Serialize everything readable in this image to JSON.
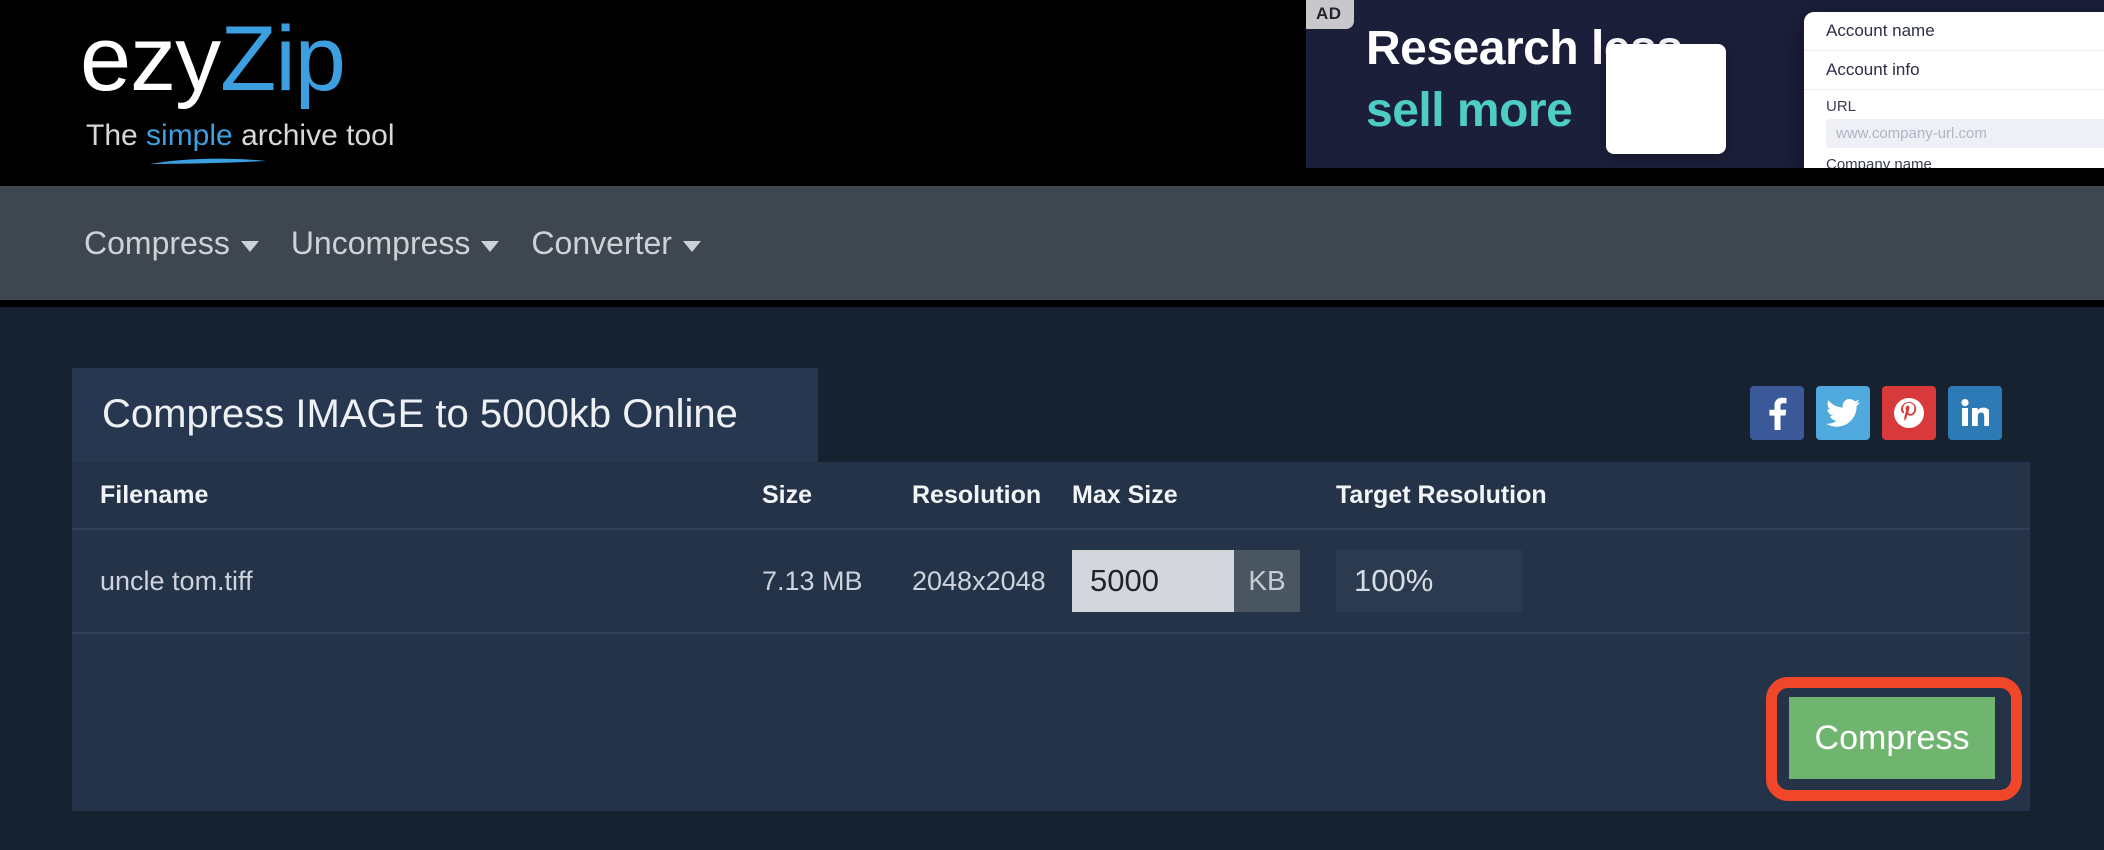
{
  "header": {
    "logo_primary": "ezy",
    "logo_secondary": "Zip",
    "tagline_before": "The ",
    "tagline_highlight": "simple",
    "tagline_after": " archive tool"
  },
  "ad": {
    "badge": "AD",
    "line1": "Research less,",
    "line2": "sell more",
    "mock": {
      "account_name": "Account name",
      "account_info": "Account info",
      "url_label": "URL",
      "url_placeholder": "www.company-url.com",
      "company_name": "Company name"
    }
  },
  "nav": {
    "items": [
      {
        "label": "Compress",
        "icon": "chevron-down-icon"
      },
      {
        "label": "Uncompress",
        "icon": "chevron-down-icon"
      },
      {
        "label": "Converter",
        "icon": "chevron-down-icon"
      }
    ]
  },
  "card": {
    "title": "Compress IMAGE to 5000kb Online",
    "social": [
      {
        "name": "facebook",
        "glyph": "f",
        "color": "#3b5998"
      },
      {
        "name": "twitter",
        "glyph": "t",
        "color": "#4fa9dd"
      },
      {
        "name": "pinterest",
        "glyph": "p",
        "color": "#d8393b"
      },
      {
        "name": "linkedin",
        "glyph": "in",
        "color": "#2d7bb6"
      }
    ],
    "table": {
      "headers": {
        "filename": "Filename",
        "size": "Size",
        "resolution": "Resolution",
        "max_size": "Max Size",
        "target_resolution": "Target Resolution"
      },
      "rows": [
        {
          "filename": "uncle tom.tiff",
          "size": "7.13 MB",
          "resolution": "2048x2048",
          "max_size_value": "5000",
          "max_size_unit": "KB",
          "target_resolution_value": "100%"
        }
      ]
    },
    "compress_button": "Compress",
    "highlight_color": "#f0462a",
    "compress_button_color": "#6fb56f"
  }
}
